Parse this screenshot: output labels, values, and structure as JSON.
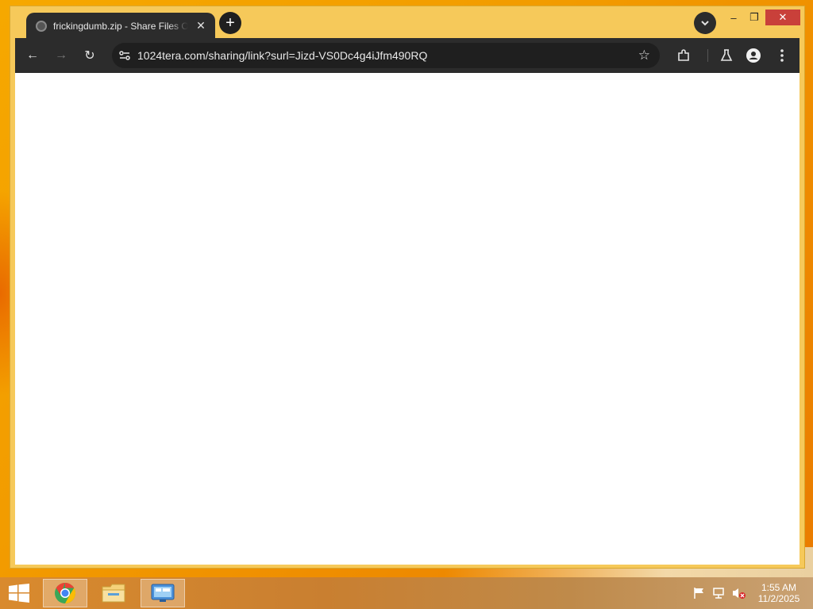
{
  "browser": {
    "tab": {
      "title": "frickingdumb.zip - Share Files O",
      "close_glyph": "✕"
    },
    "new_tab_glyph": "+",
    "window_controls": {
      "minimize": "–",
      "maximize": "❐",
      "close": "✕"
    },
    "toolbar": {
      "back": "←",
      "forward": "→",
      "reload": "↻",
      "url": "1024tera.com/sharing/link?surl=Jizd-VS0Dc4g4iJfm490RQ",
      "bookmark": "☆"
    },
    "icons": [
      "tab-favicon-icon",
      "new-tab-icon",
      "tab-search-icon",
      "site-settings-icon",
      "bookmark-star-icon",
      "extensions-icon",
      "labs-flask-icon",
      "profile-icon",
      "menu-kebab-icon"
    ]
  },
  "taskbar": {
    "apps": [
      {
        "name": "chrome",
        "active": true
      },
      {
        "name": "file-explorer",
        "active": false
      },
      {
        "name": "remote-desktop",
        "active": true
      }
    ],
    "clock": {
      "time": "1:55 AM",
      "date": "11/2/2025"
    },
    "tray_icons": [
      "action-center-flag-icon",
      "network-icon",
      "volume-muted-icon"
    ]
  },
  "colors": {
    "window_frame": "#f6c95a",
    "browser_chrome": "#2c2c2c",
    "close_button": "#c9403a",
    "desktop": "#f29b00"
  }
}
